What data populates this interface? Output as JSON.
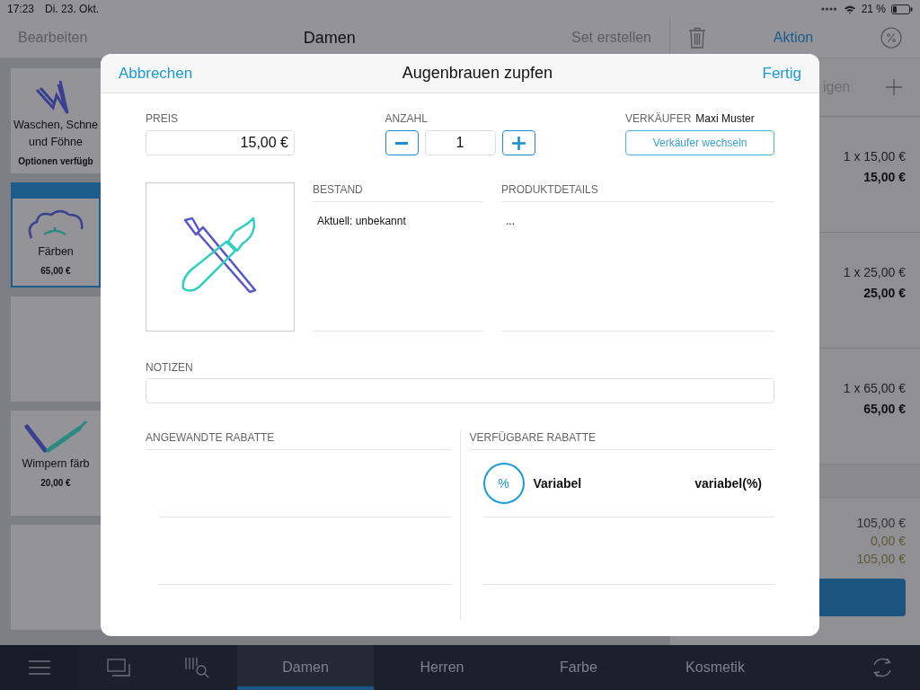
{
  "status_bar": {
    "time": "17:23",
    "date": "Di. 23. Okt.",
    "battery": "21 %"
  },
  "nav": {
    "edit": "Bearbeiten",
    "title": "Damen",
    "create_set": "Set erstellen",
    "action": "Aktion"
  },
  "tiles": [
    {
      "kind": "product",
      "lines": [
        "Waschen, Schne",
        "und Föhne"
      ],
      "subtitle": "Optionen verfügb",
      "selected": false
    },
    {
      "kind": "product",
      "lines": [
        "Färben"
      ],
      "subtitle": "65,00 €",
      "selected": true
    },
    {
      "kind": "empty",
      "selected": false
    },
    {
      "kind": "product",
      "lines": [
        "Wimpern färb"
      ],
      "subtitle": "20,00 €",
      "selected": false
    },
    {
      "kind": "empty",
      "selected": false
    }
  ],
  "cart": {
    "header_button": "igen",
    "items": [
      {
        "quantity_price": "1 x 15,00 €",
        "total": "15,00 €"
      },
      {
        "quantity_price": "1 x 25,00 €",
        "total": "25,00 €"
      },
      {
        "quantity_price": "1 x 65,00 €",
        "total": "65,00 €"
      }
    ],
    "totals": [
      {
        "value": "105,00 €",
        "kind": "plain"
      },
      {
        "value": "0,00 €",
        "kind": "muted"
      },
      {
        "value": "105,00 €",
        "kind": "muted"
      }
    ]
  },
  "bottom_tabs": [
    {
      "label": "Damen",
      "selected": true
    },
    {
      "label": "Herren",
      "selected": false
    },
    {
      "label": "Farbe",
      "selected": false
    },
    {
      "label": "Kosmetik",
      "selected": false
    }
  ],
  "modal": {
    "title": "Augenbrauen zupfen",
    "cancel": "Abbrechen",
    "done": "Fertig",
    "price": {
      "label": "PREIS",
      "value": "15,00 €"
    },
    "quantity": {
      "label": "ANZAHL",
      "value": "1"
    },
    "seller": {
      "label": "VERKÄUFER",
      "name": "Maxi Muster",
      "button": "Verkäufer wechseln"
    },
    "stock": {
      "label": "BESTAND",
      "text": "Aktuell: unbekannt"
    },
    "details": {
      "label": "PRODUKTDETAILS",
      "text": "..."
    },
    "notes": {
      "label": "NOTIZEN"
    },
    "applied_discounts": {
      "label": "ANGEWANDTE RABATTE"
    },
    "available_discounts": {
      "label": "VERFÜGBARE RABATTE",
      "items": [
        {
          "symbol": "%",
          "name": "Variabel",
          "value": "variabel(%)"
        }
      ]
    }
  }
}
